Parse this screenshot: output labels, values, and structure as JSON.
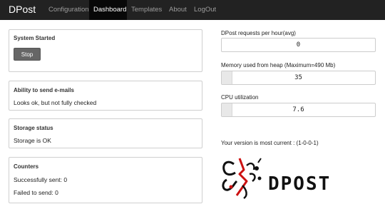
{
  "nav": {
    "brand": "DPost",
    "items": [
      {
        "label": "Configuration"
      },
      {
        "label": "Dashboard"
      },
      {
        "label": "Templates"
      },
      {
        "label": "About"
      },
      {
        "label": "LogOut"
      }
    ],
    "active": "Dashboard"
  },
  "panels": {
    "system": {
      "title": "System Started",
      "button": "Stop"
    },
    "email": {
      "title": "Ability to send e-mails",
      "text": "Looks ok, but not fully checked"
    },
    "storage": {
      "title": "Storage status",
      "text": "Storage is OK"
    },
    "counters": {
      "title": "Counters",
      "sent": "Successfully sent: 0",
      "failed": "Failed to send: 0"
    }
  },
  "metrics": {
    "requests": {
      "label": "DPost requests per hour(avg)",
      "value": "0"
    },
    "memory": {
      "label": "Memory used from heap (Maximum=490 Mb)",
      "value": "35"
    },
    "cpu": {
      "label": "CPU utilization",
      "value": "7.6"
    }
  },
  "version": "Your version is most current : (1-0-0-1)",
  "logo_text": "DPOST",
  "colors": {
    "navbar": "#222222",
    "logo_red": "#cc1111",
    "logo_black": "#111111"
  }
}
